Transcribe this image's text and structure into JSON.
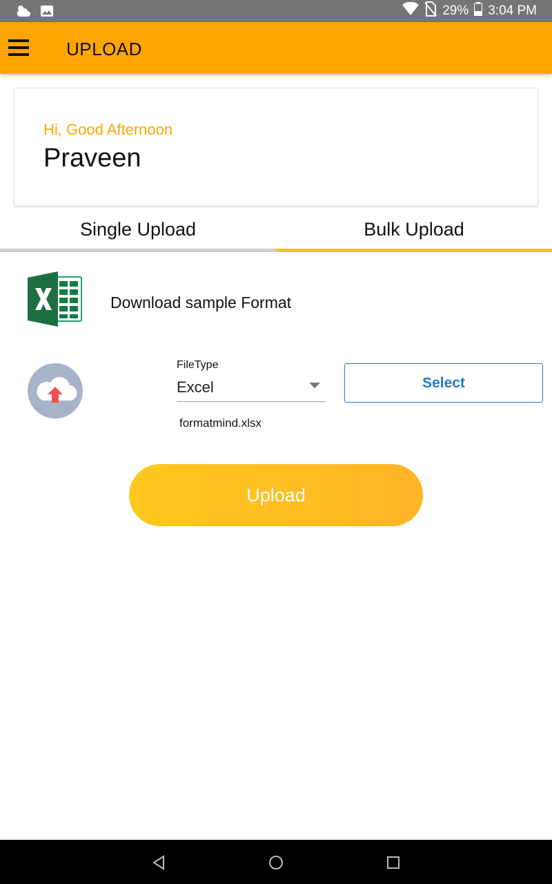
{
  "status_bar": {
    "icons_left": [
      "weather-icon",
      "image-icon"
    ],
    "icons_right": [
      "wifi-icon",
      "no-sim-icon",
      "battery-icon"
    ],
    "battery": "29%",
    "time": "3:04 PM"
  },
  "app_bar": {
    "title": "UPLOAD",
    "menu_icon": "hamburger-menu-icon",
    "color": "#FFA502"
  },
  "greeting_card": {
    "greeting": "Hi, Good Afternoon",
    "name": "Praveen"
  },
  "tabs": [
    {
      "label": "Single Upload",
      "active": false
    },
    {
      "label": "Bulk Upload",
      "active": true
    }
  ],
  "bulk_upload": {
    "download_icon": "excel-icon",
    "download_label": "Download sample Format",
    "upload_icon": "cloud-upload-icon",
    "filetype_label": "FileType",
    "filetype_value": "Excel",
    "select_label": "Select",
    "file_name": "formatmind.xlsx",
    "upload_label": "Upload"
  },
  "colors": {
    "accent": "#FFA502",
    "tab_indicator": "#FFC21A",
    "link_blue": "#1F7AC8"
  },
  "nav_bar": {
    "icons": [
      "back-icon",
      "home-icon",
      "recents-icon"
    ]
  }
}
